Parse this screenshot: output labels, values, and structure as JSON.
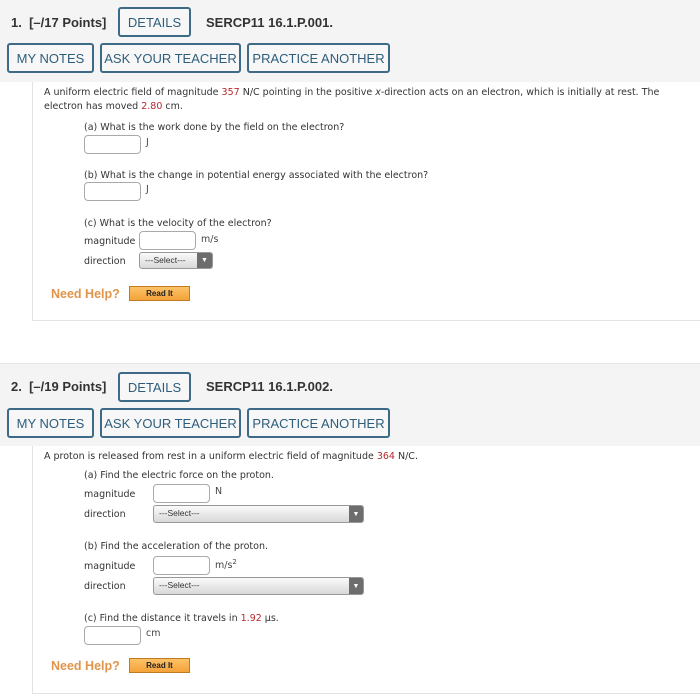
{
  "questions": [
    {
      "number_label": "1.",
      "points_label": "[–/17 Points]",
      "details_label": "DETAILS",
      "code": "SERCP11 16.1.P.001.",
      "buttons": {
        "my_notes": "MY NOTES",
        "ask_teacher": "ASK YOUR TEACHER",
        "practice_another": "PRACTICE ANOTHER"
      },
      "prompt": {
        "part1": "A uniform electric field of magnitude ",
        "field_value": "357",
        "part2": " N/C pointing in the positive ",
        "x_var": "x",
        "part3": "-direction acts on an electron, which is initially at rest. The",
        "line2_part1": "electron has moved ",
        "distance_value": "2.80",
        "line2_part2": " cm."
      },
      "parts": {
        "a": {
          "question": "(a) What is the work done by the field on the electron?",
          "unit": "J",
          "value": ""
        },
        "b": {
          "question": "(b) What is the change in potential energy associated with the electron?",
          "unit": "J",
          "value": ""
        },
        "c": {
          "question": "(c) What is the velocity of the electron?",
          "magnitude_label": "magnitude",
          "magnitude_unit": "m/s",
          "magnitude_value": "",
          "direction_label": "direction",
          "direction_selected": "---Select---"
        }
      },
      "help": {
        "label": "Need Help?",
        "read_it": "Read It"
      }
    },
    {
      "number_label": "2.",
      "points_label": "[–/19 Points]",
      "details_label": "DETAILS",
      "code": "SERCP11 16.1.P.002.",
      "buttons": {
        "my_notes": "MY NOTES",
        "ask_teacher": "ASK YOUR TEACHER",
        "practice_another": "PRACTICE ANOTHER"
      },
      "prompt": {
        "part1": "A proton is released from rest in a uniform electric field of magnitude ",
        "field_value": "364",
        "part2": " N/C."
      },
      "parts": {
        "a": {
          "question": "(a) Find the electric force on the proton.",
          "magnitude_label": "magnitude",
          "magnitude_unit": "N",
          "magnitude_value": "",
          "direction_label": "direction",
          "direction_selected": "---Select---"
        },
        "b": {
          "question": "(b) Find the acceleration of the proton.",
          "magnitude_label": "magnitude",
          "magnitude_unit": "m/s",
          "magnitude_unit_sup": "2",
          "magnitude_value": "",
          "direction_label": "direction",
          "direction_selected": "---Select---"
        },
        "c": {
          "question_part1": "(c) Find the distance it travels in ",
          "time_value": "1.92",
          "question_part2": " μs.",
          "unit": "cm",
          "value": ""
        }
      },
      "help": {
        "label": "Need Help?",
        "read_it": "Read It"
      }
    }
  ],
  "icons": {
    "dropdown_arrow": "▼"
  }
}
